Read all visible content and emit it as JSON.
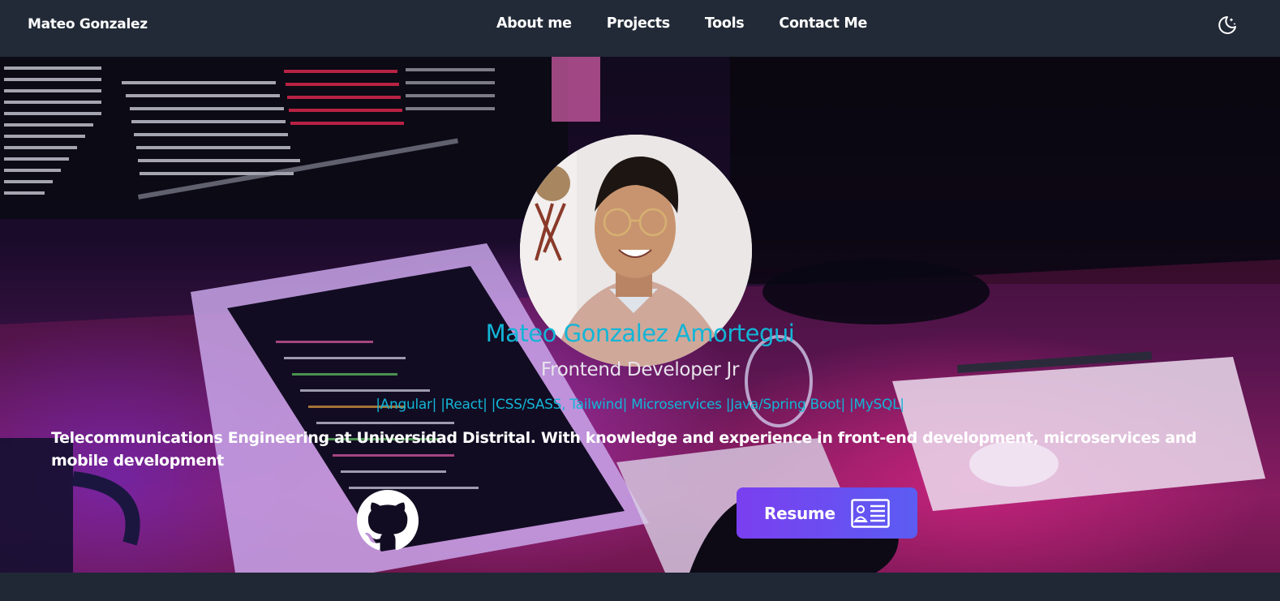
{
  "navbar": {
    "brand": "Mateo Gonzalez",
    "links": [
      "About me",
      "Projects",
      "Tools",
      "Contact Me"
    ],
    "theme_toggle_icon": "moon-stars-icon"
  },
  "hero": {
    "name": "Mateo Gonzalez Amortegui",
    "role": "Frontend Developer Jr",
    "skills": "|Angular| |React| |CSS/SASS, Tailwind| Microservices |Java/Spring Boot| |MySQL|",
    "bio": "Telecommunications Engineering at Universidad Distrital. With knowledge and experience in front-end development, microservices and mobile development",
    "github_icon": "github-icon",
    "resume": {
      "label": "Resume",
      "icon": "resume-card-icon"
    }
  },
  "colors": {
    "navbar_bg": "#222a37",
    "accent_cyan": "#12b5d6",
    "button_gradient_start": "#7a3ff0",
    "button_gradient_end": "#5b5cf2"
  }
}
